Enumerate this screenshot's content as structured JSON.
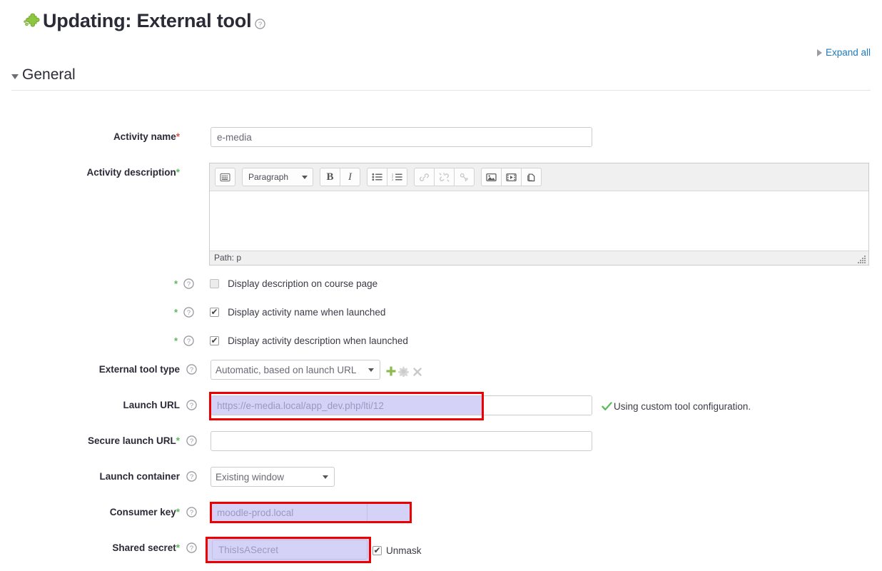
{
  "header": {
    "title": "Updating: External tool",
    "icon": "puzzle-piece-icon",
    "help_icon": "help-circle-icon"
  },
  "expand_all": {
    "label": "Expand all",
    "icon": "triangle-right-icon"
  },
  "section": {
    "title": "General",
    "collapse_icon": "triangle-down-icon",
    "expanded": true
  },
  "editor": {
    "toolbar": [
      {
        "name": "expand-toolbar-button",
        "glyph": "keyboard-icon"
      },
      {
        "name": "paragraph-style-select",
        "label": "Paragraph"
      },
      {
        "name": "bold-button",
        "glyph": "B"
      },
      {
        "name": "italic-button",
        "glyph": "I"
      },
      {
        "name": "unordered-list-button",
        "glyph": "bullet-list-icon"
      },
      {
        "name": "ordered-list-button",
        "glyph": "numbered-list-icon"
      },
      {
        "name": "link-button",
        "glyph": "link-icon"
      },
      {
        "name": "unlink-button",
        "glyph": "unlink-icon"
      },
      {
        "name": "anchor-button",
        "glyph": "anchor-icon"
      },
      {
        "name": "insert-image-button",
        "glyph": "image-icon"
      },
      {
        "name": "insert-media-button",
        "glyph": "film-icon"
      },
      {
        "name": "manage-files-button",
        "glyph": "file-icon"
      }
    ],
    "status_path": "Path: p",
    "content": ""
  },
  "fields": {
    "activity_name": {
      "label": "Activity name",
      "required_mark": "*",
      "required_color": "#d9534f",
      "value": "e-media"
    },
    "activity_description": {
      "label": "Activity description",
      "required_mark": "*",
      "required_color": "#5cb85c"
    },
    "display_description_on_course_page": {
      "label": "Display description on course page",
      "checked": false,
      "required_mark": "*"
    },
    "display_activity_name_when_launched": {
      "label": "Display activity name when launched",
      "checked": true,
      "required_mark": "*"
    },
    "display_activity_description_when_launched": {
      "label": "Display activity description when launched",
      "checked": true,
      "required_mark": "*"
    },
    "external_tool_type": {
      "label": "External tool type",
      "value": "Automatic, based on launch URL",
      "options": [
        "Automatic, based on launch URL"
      ],
      "actions": [
        "add-tool-icon",
        "edit-tool-icon",
        "delete-tool-icon"
      ]
    },
    "launch_url": {
      "label": "Launch URL",
      "value": "https://e-media.local/app_dev.php/lti/12",
      "highlighted": true,
      "note": "Using custom tool configuration.",
      "note_icon": "green-check-icon"
    },
    "secure_launch_url": {
      "label": "Secure launch URL",
      "required_mark": "*",
      "value": ""
    },
    "launch_container": {
      "label": "Launch container",
      "value": "Existing window",
      "options": [
        "Existing window"
      ]
    },
    "consumer_key": {
      "label": "Consumer key",
      "required_mark": "*",
      "value": "moodle-prod.local",
      "highlighted": true
    },
    "shared_secret": {
      "label": "Shared secret",
      "required_mark": "*",
      "value": "ThisIsASecret",
      "highlighted": true,
      "unmask_label": "Unmask",
      "unmask_checked": true
    }
  },
  "colors": {
    "link": "#1e7ab8",
    "required_red": "#d9534f",
    "required_green": "#5cb85c",
    "annotation_red": "#ee0000",
    "highlight_purple": "#b9b6f0"
  }
}
